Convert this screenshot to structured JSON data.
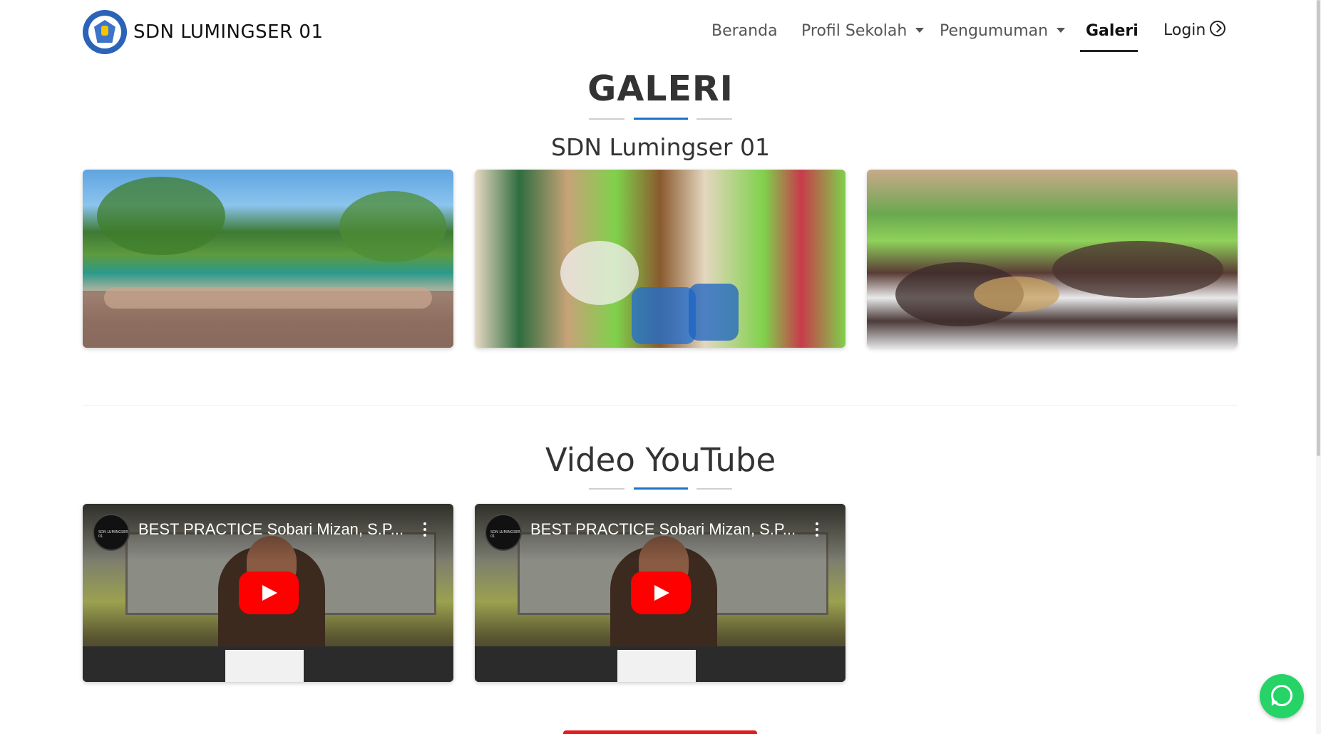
{
  "brand": {
    "name": "SDN LUMINGSER 01"
  },
  "nav": {
    "items": [
      {
        "label": "Beranda"
      },
      {
        "label": "Profil Sekolah"
      },
      {
        "label": "Pengumuman"
      },
      {
        "label": "Galeri"
      },
      {
        "label": "Login"
      }
    ]
  },
  "gallery": {
    "title": "GALERI",
    "subtitle": "SDN Lumingser 01"
  },
  "videos": {
    "title": "Video YouTube",
    "items": [
      {
        "title": "BEST PRACTICE Sobari Mizan, S.P...",
        "channel_badge": "SDN LUMINGSER 01"
      },
      {
        "title": "BEST PRACTICE Sobari Mizan, S.P...",
        "channel_badge": "SDN LUMINGSER 01"
      }
    ]
  },
  "colors": {
    "accent_blue": "#1e73c8",
    "youtube_red": "#ff0000",
    "whatsapp_green": "#25d366"
  }
}
